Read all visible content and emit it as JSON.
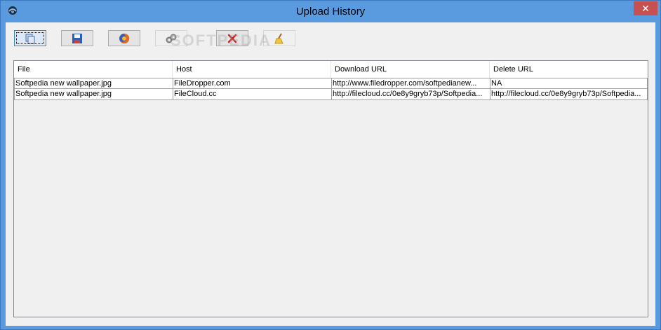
{
  "window": {
    "title": "Upload History",
    "close_label": "✕"
  },
  "watermark": "SOFTPEDIA",
  "toolbar": {
    "buttons": [
      {
        "name": "copy-button",
        "icon": "copy-icon"
      },
      {
        "name": "save-button",
        "icon": "floppy-disk-icon"
      },
      {
        "name": "open-in-browser-button",
        "icon": "firefox-icon"
      },
      {
        "name": "settings-button",
        "icon": "gears-icon"
      },
      {
        "name": "delete-button",
        "icon": "red-x-icon"
      },
      {
        "name": "clear-button",
        "icon": "broom-icon"
      }
    ]
  },
  "table": {
    "columns": [
      "File",
      "Host",
      "Download URL",
      "Delete URL"
    ],
    "rows": [
      [
        "Softpedia new wallpaper.jpg",
        "FileDropper.com",
        "http://www.filedropper.com/softpedianew...",
        "NA"
      ],
      [
        "Softpedia new wallpaper.jpg",
        "FileCloud.cc",
        "http://filecloud.cc/0e8y9gryb73p/Softpedia...",
        "http://filecloud.cc/0e8y9gryb73p/Softpedia..."
      ]
    ]
  }
}
